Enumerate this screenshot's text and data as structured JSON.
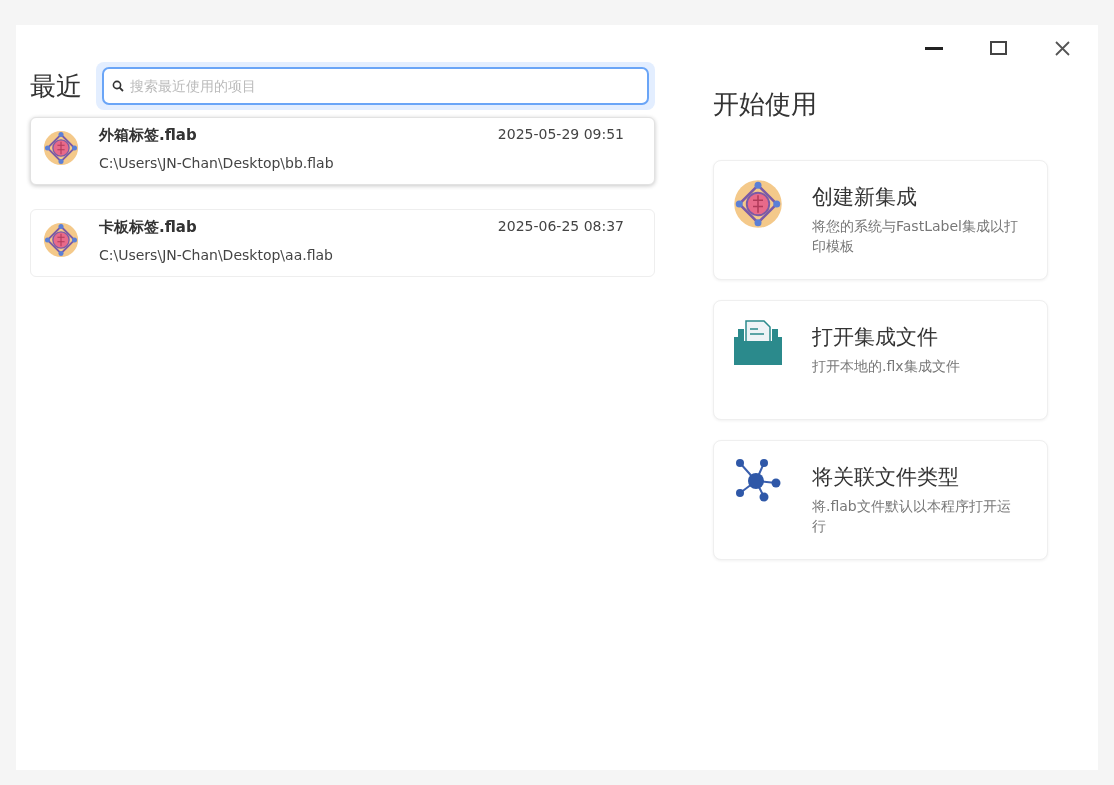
{
  "recent": {
    "title": "最近",
    "search": {
      "placeholder": "搜索最近使用的项目"
    },
    "items": [
      {
        "name": "外箱标签.flab",
        "time": "2025-05-29 09:51",
        "path": "C:\\Users\\JN-Chan\\Desktop\\bb.flab",
        "selected": true
      },
      {
        "name": "卡板标签.flab",
        "time": "2025-06-25 08:37",
        "path": "C:\\Users\\JN-Chan\\Desktop\\aa.flab",
        "selected": false
      }
    ]
  },
  "get_started": {
    "title": "开始使用",
    "actions": [
      {
        "kind": "create",
        "title": "创建新集成",
        "description": "将您的系统与FastLabel集成以打印模板"
      },
      {
        "kind": "open",
        "title": "打开集成文件",
        "description": "打开本地的.flx集成文件"
      },
      {
        "kind": "associate",
        "title": "将关联文件类型",
        "description": "将.flab文件默认以本程序打开运行"
      }
    ]
  }
}
